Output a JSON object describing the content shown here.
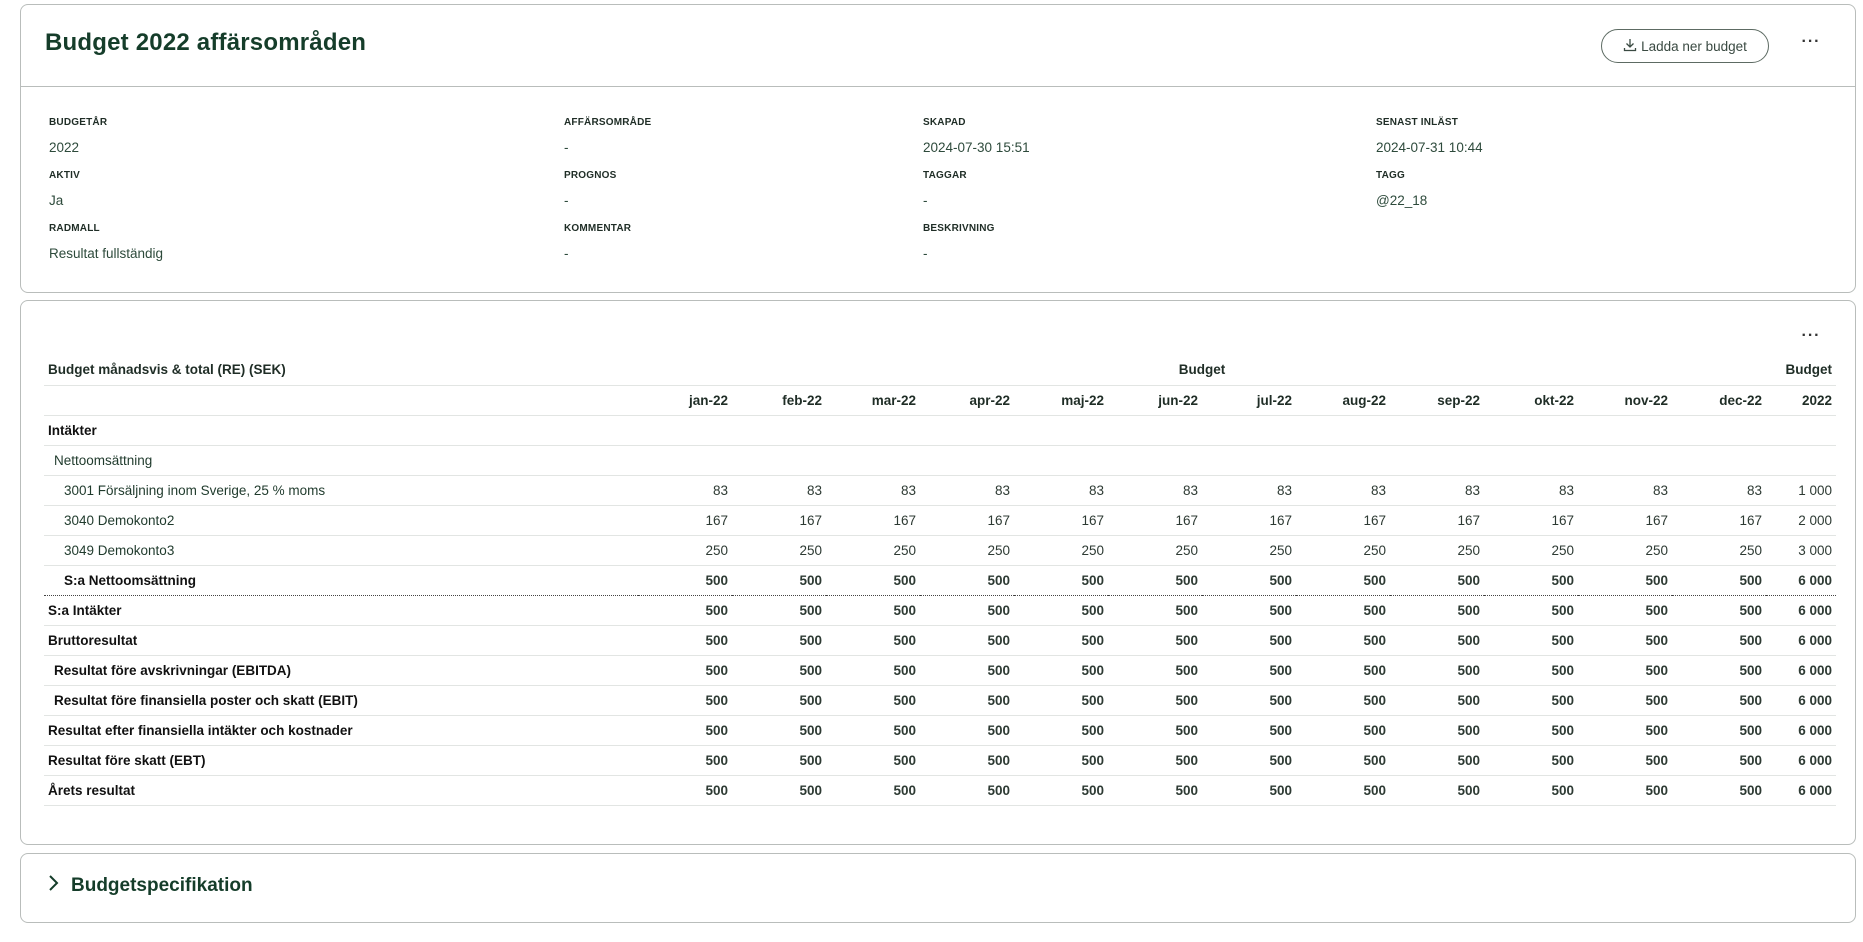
{
  "header": {
    "title": "Budget 2022 affärsområden",
    "download_label": "Ladda ner budget",
    "more_label": "···"
  },
  "meta": [
    {
      "label": "BUDGETÅR",
      "value": "2022"
    },
    {
      "label": "AFFÄRSOMRÅDE",
      "value": "-"
    },
    {
      "label": "SKAPAD",
      "value": "2024-07-30 15:51"
    },
    {
      "label": "SENAST INLÄST",
      "value": "2024-07-31 10:44"
    },
    {
      "label": "AKTIV",
      "value": "Ja"
    },
    {
      "label": "PROGNOS",
      "value": "-"
    },
    {
      "label": "TAGGAR",
      "value": "-"
    },
    {
      "label": "TAGG",
      "value": "@22_18"
    },
    {
      "label": "RADMALL",
      "value": "Resultat fullständig"
    },
    {
      "label": "KOMMENTAR",
      "value": "-"
    },
    {
      "label": "BESKRIVNING",
      "value": "-"
    }
  ],
  "table": {
    "more_label": "···",
    "caption": "Budget månadsvis & total (RE) (SEK)",
    "group_budget": "Budget",
    "group_total": "Budget",
    "columns": [
      "jan-22",
      "feb-22",
      "mar-22",
      "apr-22",
      "maj-22",
      "jun-22",
      "jul-22",
      "aug-22",
      "sep-22",
      "okt-22",
      "nov-22",
      "dec-22"
    ],
    "total_column": "2022",
    "rows": [
      {
        "label": "Intäkter",
        "level": 0,
        "bold": true,
        "values": [],
        "total": ""
      },
      {
        "label": "Nettoomsättning",
        "level": 1,
        "bold": false,
        "values": [],
        "total": ""
      },
      {
        "label": "3001 Försäljning inom Sverige, 25 % moms",
        "level": 2,
        "bold": false,
        "values": [
          "83",
          "83",
          "83",
          "83",
          "83",
          "83",
          "83",
          "83",
          "83",
          "83",
          "83",
          "83"
        ],
        "total": "1 000"
      },
      {
        "label": "3040 Demokonto2",
        "level": 2,
        "bold": false,
        "values": [
          "167",
          "167",
          "167",
          "167",
          "167",
          "167",
          "167",
          "167",
          "167",
          "167",
          "167",
          "167"
        ],
        "total": "2 000"
      },
      {
        "label": "3049 Demokonto3",
        "level": 2,
        "bold": false,
        "values": [
          "250",
          "250",
          "250",
          "250",
          "250",
          "250",
          "250",
          "250",
          "250",
          "250",
          "250",
          "250"
        ],
        "total": "3 000"
      },
      {
        "label": "S:a Nettoomsättning",
        "level": 2,
        "bold": true,
        "dotted": true,
        "values": [
          "500",
          "500",
          "500",
          "500",
          "500",
          "500",
          "500",
          "500",
          "500",
          "500",
          "500",
          "500"
        ],
        "total": "6 000"
      },
      {
        "label": "S:a Intäkter",
        "level": 0,
        "bold": true,
        "values": [
          "500",
          "500",
          "500",
          "500",
          "500",
          "500",
          "500",
          "500",
          "500",
          "500",
          "500",
          "500"
        ],
        "total": "6 000"
      },
      {
        "label": "Bruttoresultat",
        "level": 0,
        "bold": true,
        "values": [
          "500",
          "500",
          "500",
          "500",
          "500",
          "500",
          "500",
          "500",
          "500",
          "500",
          "500",
          "500"
        ],
        "total": "6 000"
      },
      {
        "label": "Resultat före avskrivningar (EBITDA)",
        "level": 1,
        "bold": true,
        "values": [
          "500",
          "500",
          "500",
          "500",
          "500",
          "500",
          "500",
          "500",
          "500",
          "500",
          "500",
          "500"
        ],
        "total": "6 000"
      },
      {
        "label": "Resultat före finansiella poster och skatt (EBIT)",
        "level": 1,
        "bold": true,
        "values": [
          "500",
          "500",
          "500",
          "500",
          "500",
          "500",
          "500",
          "500",
          "500",
          "500",
          "500",
          "500"
        ],
        "total": "6 000"
      },
      {
        "label": "Resultat efter finansiella intäkter och kostnader",
        "level": 0,
        "bold": true,
        "values": [
          "500",
          "500",
          "500",
          "500",
          "500",
          "500",
          "500",
          "500",
          "500",
          "500",
          "500",
          "500"
        ],
        "total": "6 000"
      },
      {
        "label": "Resultat före skatt (EBT)",
        "level": 0,
        "bold": true,
        "values": [
          "500",
          "500",
          "500",
          "500",
          "500",
          "500",
          "500",
          "500",
          "500",
          "500",
          "500",
          "500"
        ],
        "total": "6 000"
      },
      {
        "label": "Årets resultat",
        "level": 0,
        "bold": true,
        "values": [
          "500",
          "500",
          "500",
          "500",
          "500",
          "500",
          "500",
          "500",
          "500",
          "500",
          "500",
          "500"
        ],
        "total": "6 000"
      }
    ]
  },
  "spec": {
    "title": "Budgetspecifikation"
  }
}
